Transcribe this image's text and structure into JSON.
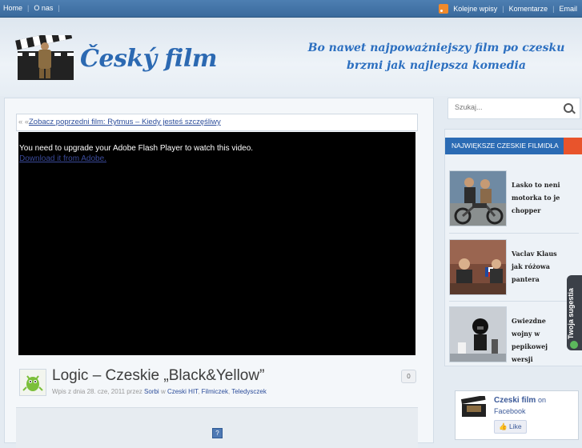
{
  "topbar": {
    "nav_left": [
      "Home",
      "O nas"
    ],
    "nav_right": [
      "Kolejne wpisy",
      "Komentarze",
      "Email"
    ]
  },
  "header": {
    "logo_text": "Český film",
    "tagline_line1": "Bo nawet najpoważniejszy film po czesku",
    "tagline_line2": "brzmi jak najlepsza komedia"
  },
  "main": {
    "prev_arrows": "« «",
    "prev_link": "Zobacz poprzedni film: Rytmus – Kiedy jesteś szczęśliwy",
    "video_message": "You need to upgrade your Adobe Flash Player to watch this video.",
    "video_download": "Download it from Adobe.",
    "post_title": "Logic – Czeskie „Black&Yellow”",
    "post_meta": {
      "prefix": "Wpis z dnia 28. cze, 2011 przez ",
      "author": "Sorbi",
      "in": " w ",
      "cat1": "Czeski HIT",
      "sep1": ", ",
      "cat2": "Filmiczek",
      "sep2": ", ",
      "cat3": "Teledysczek"
    },
    "comment_count": "0",
    "placeholder_icon": "?"
  },
  "sidebar": {
    "search_placeholder": "Szukaj...",
    "widget_title": "NAJWIĘKSZE CZESKIE FILMIDŁA",
    "items": [
      {
        "caption": "Lasko to neni motorka to je chopper"
      },
      {
        "caption": "Vaclav Klaus jak różowa pantera"
      },
      {
        "caption": "Gwiezdne wojny w pepikowej wersji"
      }
    ],
    "feedback_tab": "Twoja sugestia",
    "facebook": {
      "name": "Czeski film",
      "on": "on",
      "sub": "Facebook",
      "like": "Like"
    }
  }
}
